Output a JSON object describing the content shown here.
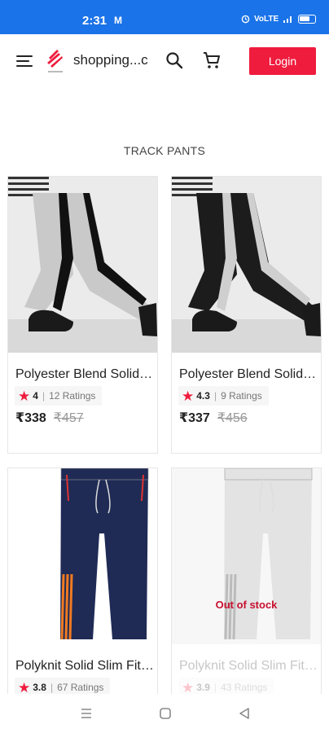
{
  "status_bar": {
    "time": "2:31",
    "notification_icon": "M",
    "right_text": "VoLTE"
  },
  "header": {
    "menu_icon": "menu-icon",
    "logo_icon": "brand-logo",
    "site_title": "shopping...c",
    "search_icon": "search-icon",
    "cart_icon": "cart-icon",
    "login_label": "Login",
    "brand_color": "#ef1c3d"
  },
  "section": {
    "title": "TRACK PANTS"
  },
  "products": [
    {
      "name": "Polyester Blend Solid Men Grey Track Pants",
      "rating": "4",
      "ratings_count": "12 Ratings",
      "price": "₹338",
      "mrp": "₹457",
      "pant_color": "#c9c9c9",
      "stripe_color": "#111111",
      "in_stock": true
    },
    {
      "name": "Polyester Blend Solid Men Black Track Pants",
      "rating": "4.3",
      "ratings_count": "9 Ratings",
      "price": "₹337",
      "mrp": "₹456",
      "pant_color": "#1c1c1c",
      "stripe_color": "#cfcfcf",
      "in_stock": true
    },
    {
      "name": "Polyknit Solid Slim Fit Men Navy Track Pants",
      "rating": "3.8",
      "ratings_count": "67 Ratings",
      "price": "",
      "mrp": "",
      "pant_color": "#1f2b55",
      "stripe_color": "#f07a22",
      "in_stock": true
    },
    {
      "name": "Polyknit Solid Slim Fit Men White Track Pants",
      "rating": "3.9",
      "ratings_count": "43 Ratings",
      "price": "",
      "mrp": "",
      "pant_color": "#e3e3e3",
      "stripe_color": "#bbbbbb",
      "in_stock": false,
      "stock_label": "Out of stock"
    }
  ],
  "nav_bar": {
    "recents_icon": "recents-icon",
    "home_icon": "home-icon",
    "back_icon": "back-icon"
  }
}
